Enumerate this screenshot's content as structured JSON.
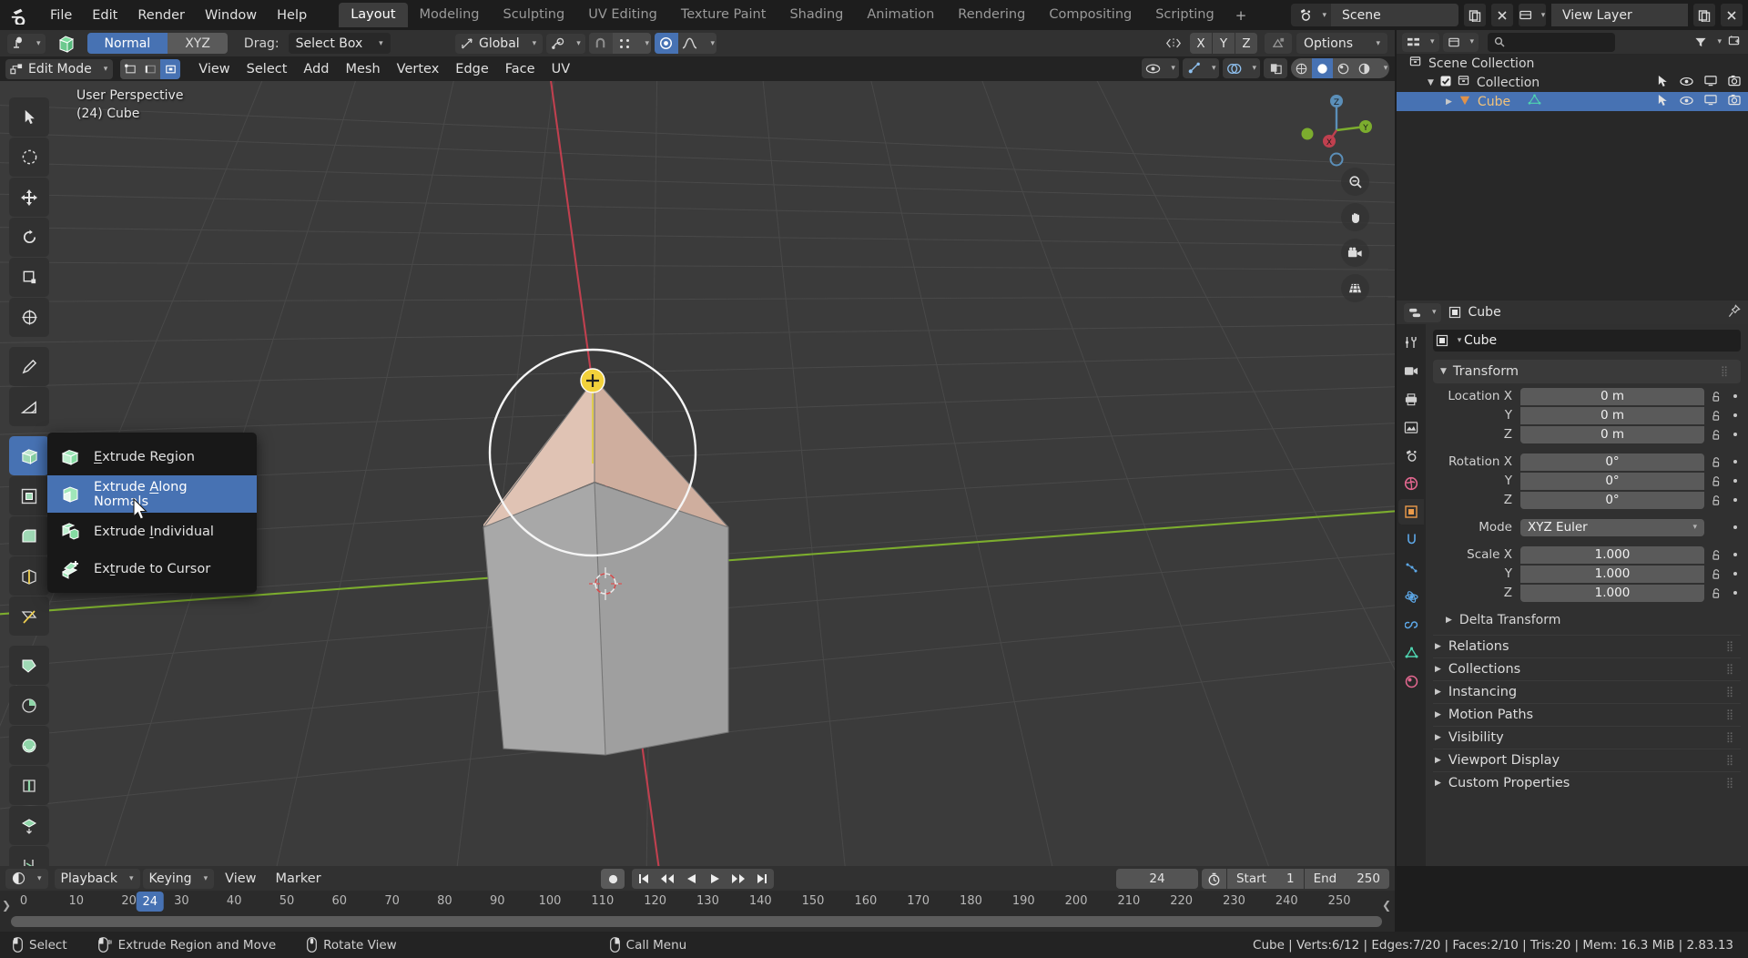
{
  "topbar": {
    "menus": [
      "File",
      "Edit",
      "Render",
      "Window",
      "Help"
    ],
    "workspaces": [
      {
        "label": "Layout",
        "active": true
      },
      {
        "label": "Modeling",
        "active": false
      },
      {
        "label": "Sculpting",
        "active": false
      },
      {
        "label": "UV Editing",
        "active": false
      },
      {
        "label": "Texture Paint",
        "active": false
      },
      {
        "label": "Shading",
        "active": false
      },
      {
        "label": "Animation",
        "active": false
      },
      {
        "label": "Rendering",
        "active": false
      },
      {
        "label": "Compositing",
        "active": false
      },
      {
        "label": "Scripting",
        "active": false
      }
    ],
    "add_workspace_label": "+",
    "scene_name": "Scene",
    "view_layer_name": "View Layer"
  },
  "toolsettings": {
    "orientation_options": [
      "Normal",
      "XYZ"
    ],
    "orientation_active": "Normal",
    "drag_label": "Drag:",
    "drag_value": "Select Box",
    "transform_orientation": "Global",
    "axis_x": "X",
    "axis_y": "Y",
    "axis_z": "Z",
    "options_label": "Options"
  },
  "viewheader": {
    "mode": "Edit Mode",
    "menus": [
      "View",
      "Select",
      "Add",
      "Mesh",
      "Vertex",
      "Edge",
      "Face",
      "UV"
    ]
  },
  "viewport": {
    "perspective_label": "User Perspective",
    "object_label": "(24) Cube",
    "axis_labels": {
      "x": "X",
      "y": "Y",
      "z": "Z"
    }
  },
  "popup_menu": {
    "title": "extrude-menu",
    "items": [
      {
        "label": "Extrude Region",
        "accel": "E",
        "icon": "extrude-region-icon",
        "highlighted": false
      },
      {
        "label": "Extrude Along Normals",
        "accel": "A",
        "icon": "extrude-normals-icon",
        "highlighted": true
      },
      {
        "label": "Extrude Individual",
        "accel": "I",
        "icon": "extrude-individual-icon",
        "highlighted": false
      },
      {
        "label": "Extrude to Cursor",
        "accel": "C",
        "icon": "extrude-cursor-icon",
        "highlighted": false
      }
    ]
  },
  "outliner": {
    "rows": [
      {
        "label": "Scene Collection",
        "icon": "collection-icon",
        "indent": 0,
        "selected": false,
        "has_toggles": false,
        "checkbox": false,
        "disclosure": ""
      },
      {
        "label": "Collection",
        "icon": "collection-icon",
        "indent": 1,
        "selected": false,
        "has_toggles": true,
        "checkbox": true,
        "disclosure": "down"
      },
      {
        "label": "Cube",
        "icon": "mesh-object-icon",
        "indent": 2,
        "selected": true,
        "has_toggles": true,
        "checkbox": false,
        "disclosure": "right"
      }
    ]
  },
  "properties": {
    "breadcrumb_object": "Cube",
    "object_name_value": "Cube",
    "transform_title": "Transform",
    "location": {
      "label": "Location X",
      "x": "0 m",
      "y": "0 m",
      "z": "0 m",
      "ylabel": "Y",
      "zlabel": "Z"
    },
    "rotation": {
      "label": "Rotation X",
      "x": "0°",
      "y": "0°",
      "z": "0°",
      "ylabel": "Y",
      "zlabel": "Z"
    },
    "mode": {
      "label": "Mode",
      "value": "XYZ Euler"
    },
    "scale": {
      "label": "Scale X",
      "x": "1.000",
      "y": "1.000",
      "z": "1.000",
      "ylabel": "Y",
      "zlabel": "Z"
    },
    "delta_transform": "Delta Transform",
    "panels": [
      "Relations",
      "Collections",
      "Instancing",
      "Motion Paths",
      "Visibility",
      "Viewport Display",
      "Custom Properties"
    ]
  },
  "timeline": {
    "editor_menus": [
      "Playback",
      "Keying",
      "View",
      "Marker"
    ],
    "current_frame": "24",
    "start_label": "Start",
    "start_value": "1",
    "end_label": "End",
    "end_value": "250",
    "ticks": [
      0,
      10,
      20,
      30,
      40,
      50,
      60,
      70,
      80,
      90,
      100,
      110,
      120,
      130,
      140,
      150,
      160,
      170,
      180,
      190,
      200,
      210,
      220,
      230,
      240,
      250
    ],
    "playhead_frame": 24
  },
  "statusbar": {
    "hints": [
      {
        "icon": "mouse-left-icon",
        "label": "Select"
      },
      {
        "icon": "mouse-left-drag-icon",
        "label": "Extrude Region and Move"
      },
      {
        "icon": "mouse-middle-icon",
        "label": "Rotate View"
      },
      {
        "icon": "mouse-right-icon",
        "label": "Call Menu"
      }
    ],
    "stats": "Cube | Verts:6/12 | Edges:7/20 | Faces:2/10 | Tris:20 | Mem: 16.3 MiB | 2.83.13"
  },
  "colors": {
    "accent": "#4772b3",
    "viewport_bg": "#3b3b3b",
    "panel_bg": "#303030",
    "header_bg": "#313131",
    "axis_x": "#c04f5e",
    "axis_y": "#7cad2e",
    "highlight_face": "#d9b7a8",
    "cube_gray": "#a5a5a5"
  }
}
